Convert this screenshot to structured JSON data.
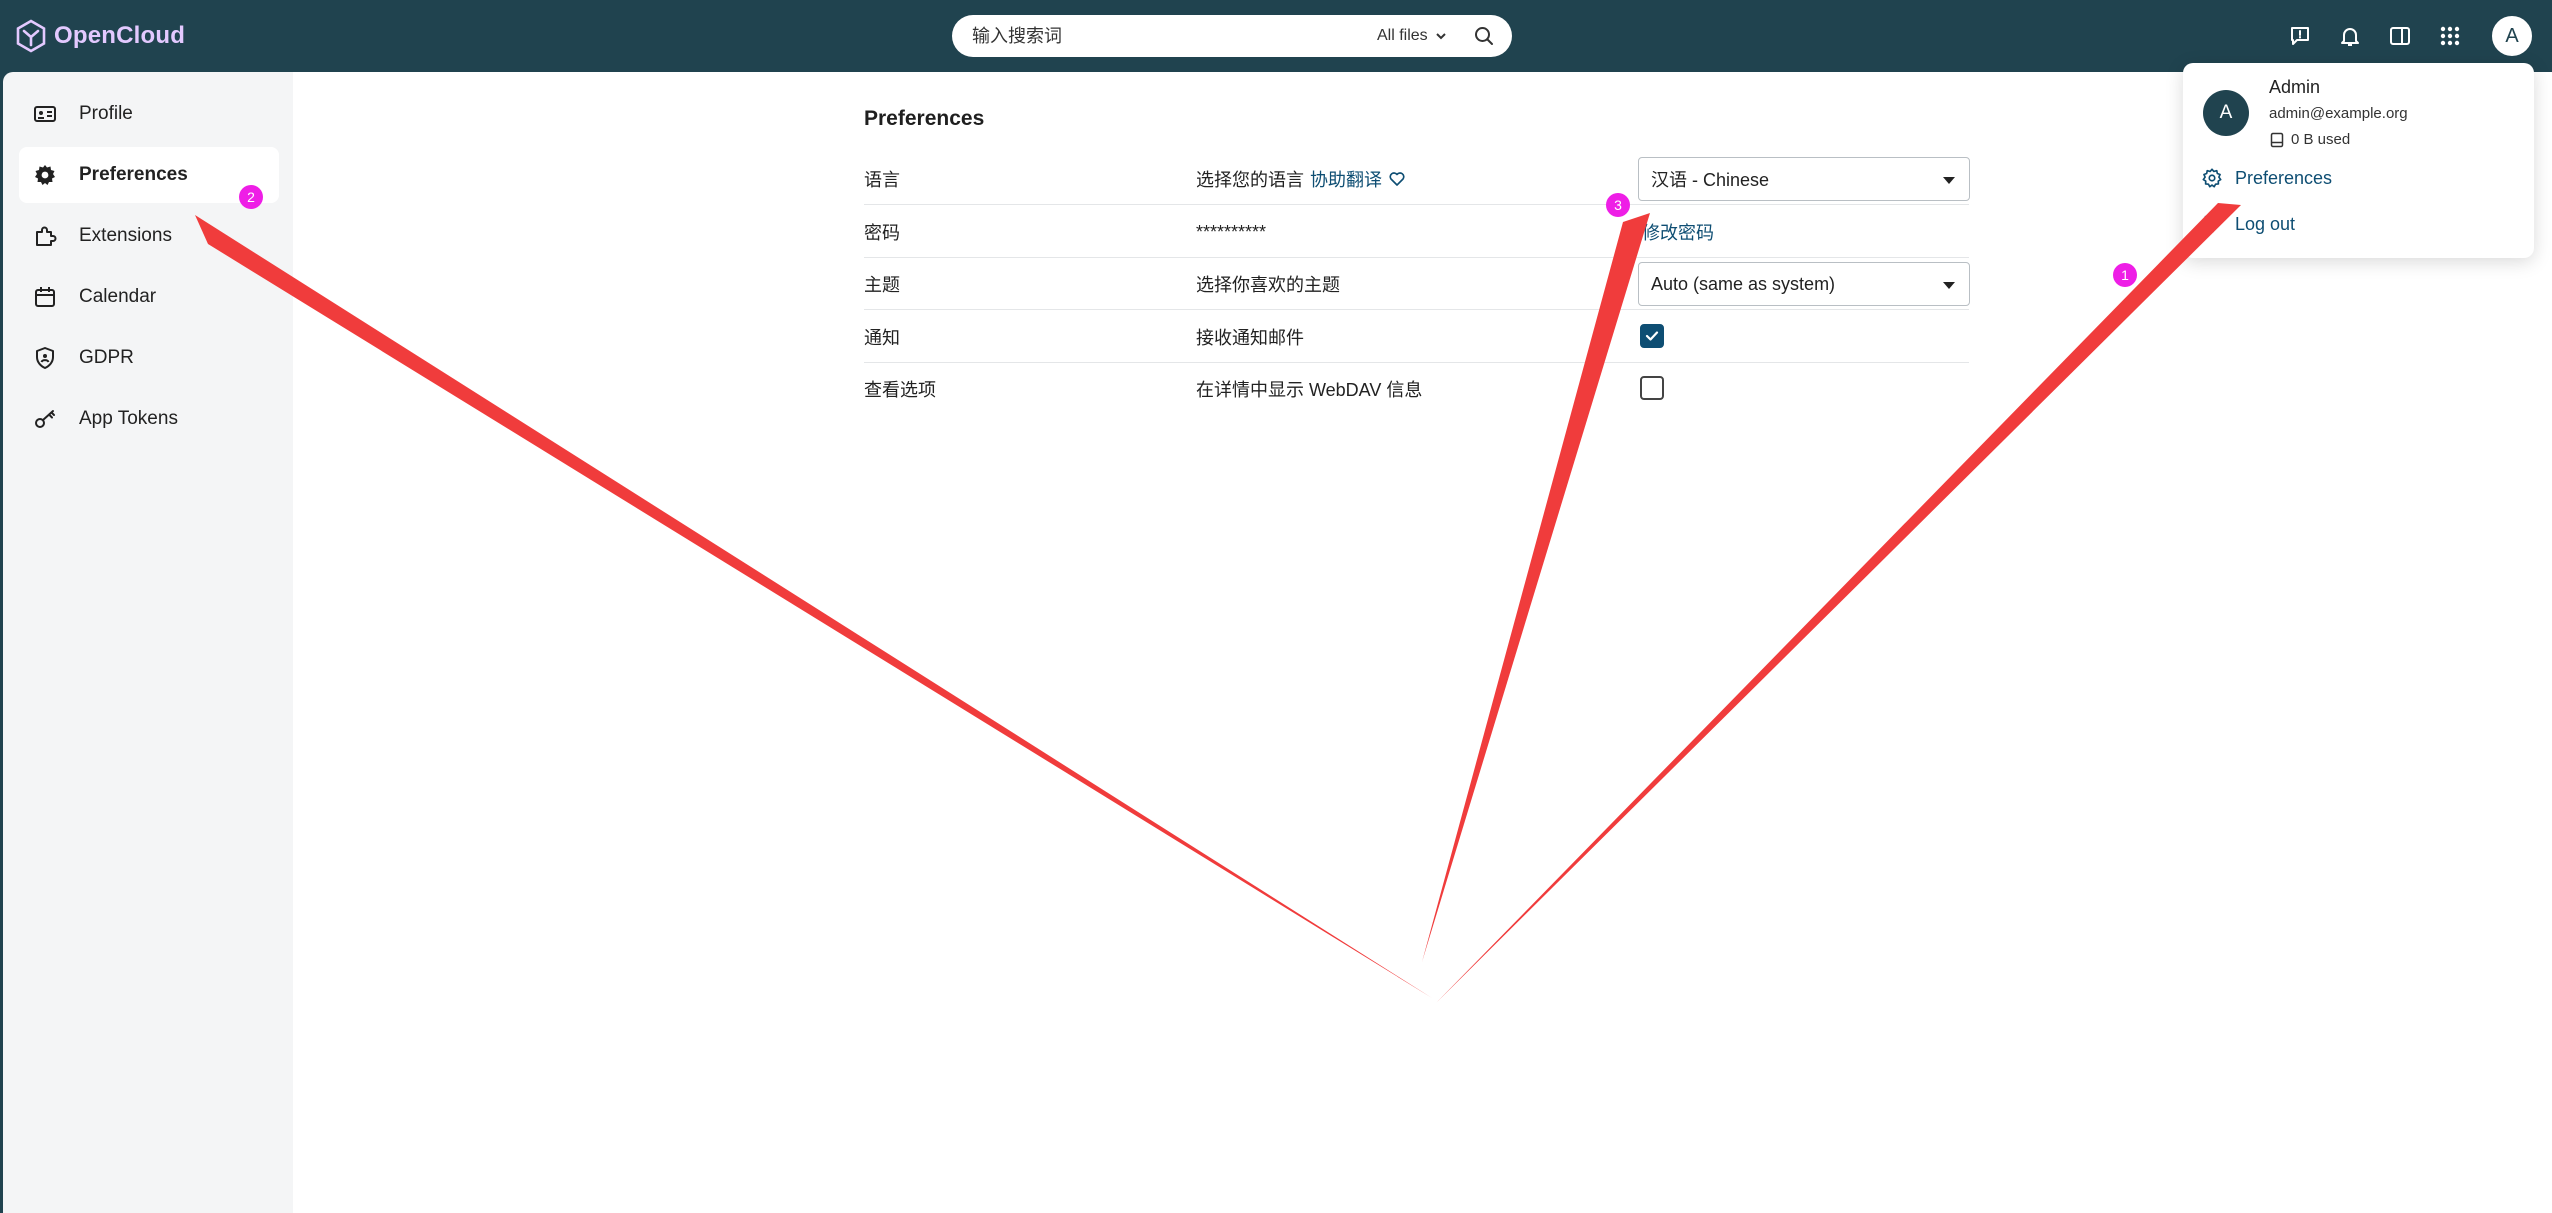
{
  "app": {
    "name": "OpenCloud"
  },
  "search": {
    "placeholder": "输入搜索词",
    "scope_label": "All files"
  },
  "user": {
    "initial": "A",
    "name": "Admin",
    "email": "admin@example.org",
    "quota": "0 B used"
  },
  "user_menu": {
    "preferences": "Preferences",
    "logout": "Log out"
  },
  "sidebar": {
    "items": [
      {
        "label": "Profile",
        "icon": "id-card-icon"
      },
      {
        "label": "Preferences",
        "icon": "gear-icon",
        "active": true
      },
      {
        "label": "Extensions",
        "icon": "puzzle-icon"
      },
      {
        "label": "Calendar",
        "icon": "calendar-icon"
      },
      {
        "label": "GDPR",
        "icon": "shield-icon"
      },
      {
        "label": "App Tokens",
        "icon": "key-icon"
      }
    ]
  },
  "preferences": {
    "title": "Preferences",
    "rows": [
      {
        "label": "语言",
        "desc": "选择您的语言",
        "help_link": "协助翻译",
        "control": "select",
        "value": "汉语 - Chinese"
      },
      {
        "label": "密码",
        "desc": "**********",
        "control": "link",
        "value": "修改密码"
      },
      {
        "label": "主题",
        "desc": "选择你喜欢的主题",
        "control": "select",
        "value": "Auto (same as system)"
      },
      {
        "label": "通知",
        "desc": "接收通知邮件",
        "control": "checkbox",
        "checked": true
      },
      {
        "label": "查看选项",
        "desc": "在详情中显示 WebDAV 信息",
        "control": "checkbox",
        "checked": false
      }
    ]
  },
  "annotations": {
    "badge_1": "1",
    "badge_2": "2",
    "badge_3": "3",
    "arrow_color": "#f03c3c",
    "badge_color": "#ee1ee6"
  }
}
